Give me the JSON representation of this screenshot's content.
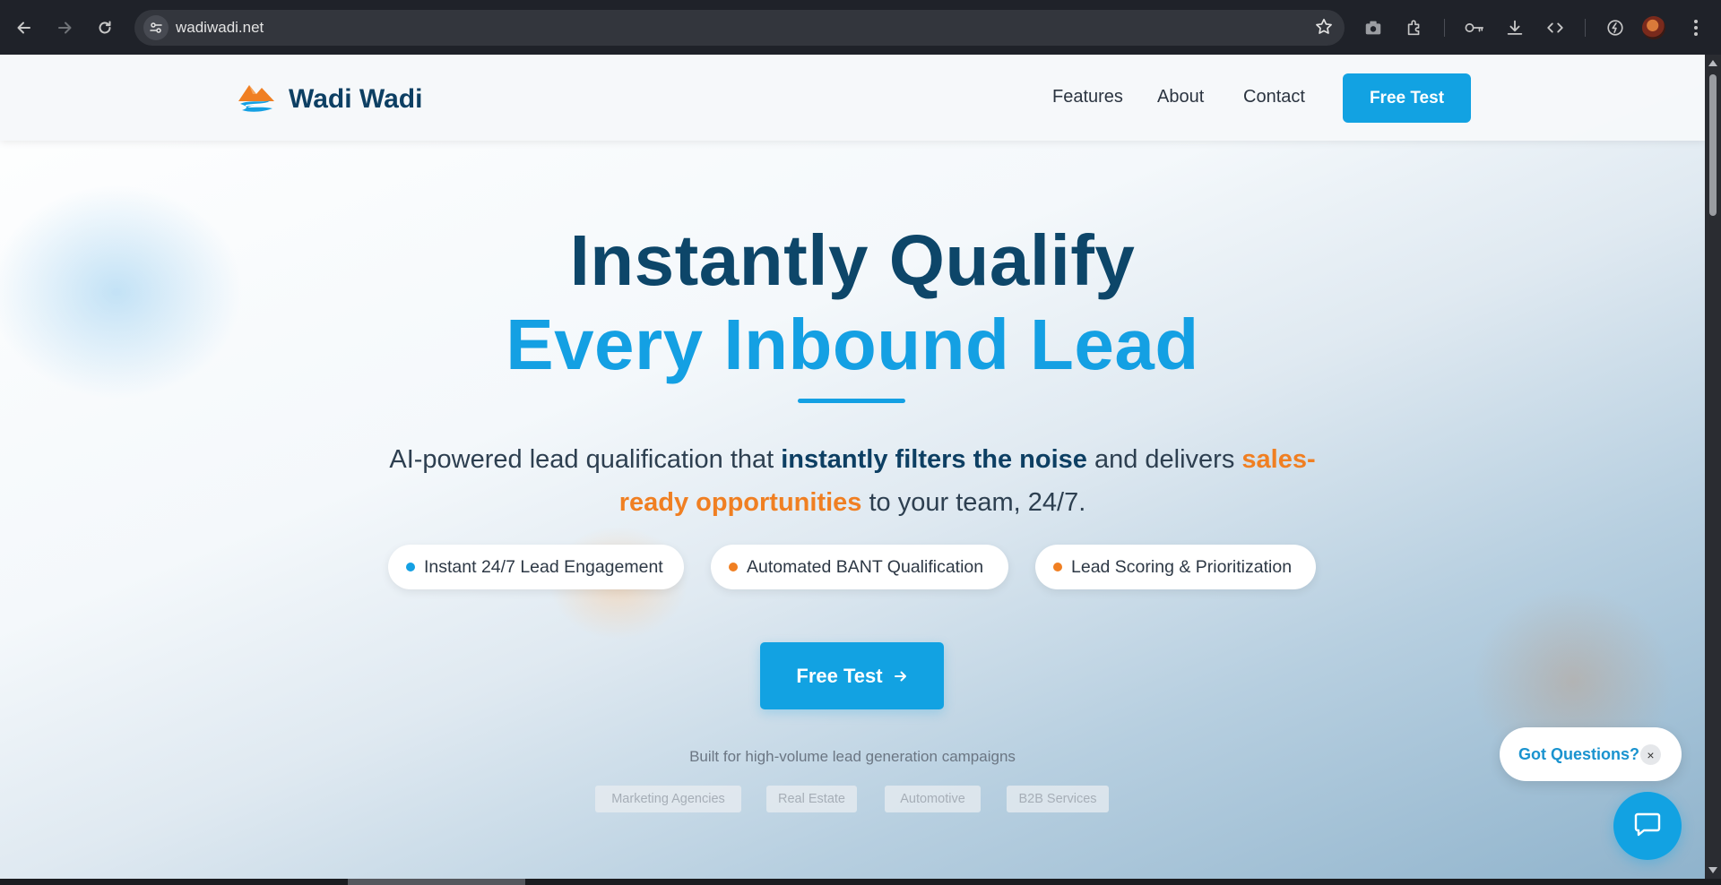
{
  "browser": {
    "url": "wadiwadi.net",
    "icons": [
      "back-arrow-icon",
      "forward-arrow-icon",
      "reload-icon",
      "site-settings-icon",
      "bookmark-star-icon",
      "camera-icon",
      "extensions-icon",
      "password-key-icon",
      "download-icon",
      "code-icon",
      "performance-icon",
      "profile-avatar",
      "more-menu-icon"
    ]
  },
  "header": {
    "brand": "Wadi Wadi",
    "nav": [
      "Features",
      "About",
      "Contact"
    ],
    "cta": "Free Test"
  },
  "hero": {
    "title_line1": "Instantly Qualify",
    "title_line2": "Every Inbound Lead",
    "subtitle": {
      "part1": "AI-powered lead qualification that ",
      "strong": "instantly filters the noise",
      "part2": " and delivers ",
      "highlight": "sales-ready opportunities",
      "part3": " to your team, 24/7."
    },
    "features": [
      {
        "label": "Instant 24/7 Lead Engagement",
        "dot_color": "#14a0e3"
      },
      {
        "label": "Automated BANT Qualification",
        "dot_color": "#f07f22"
      },
      {
        "label": "Lead Scoring & Prioritization",
        "dot_color": "#f07f22"
      }
    ],
    "cta": "Free Test",
    "built_for": "Built for high-volume lead generation campaigns",
    "tags": [
      "Marketing Agencies",
      "Real Estate",
      "Automotive",
      "B2B Services"
    ]
  },
  "chat": {
    "prompt": "Got Questions?",
    "close": "×"
  },
  "colors": {
    "primary": "#12a2e2",
    "navy": "#0d3f63",
    "accent_orange": "#f07f22"
  }
}
